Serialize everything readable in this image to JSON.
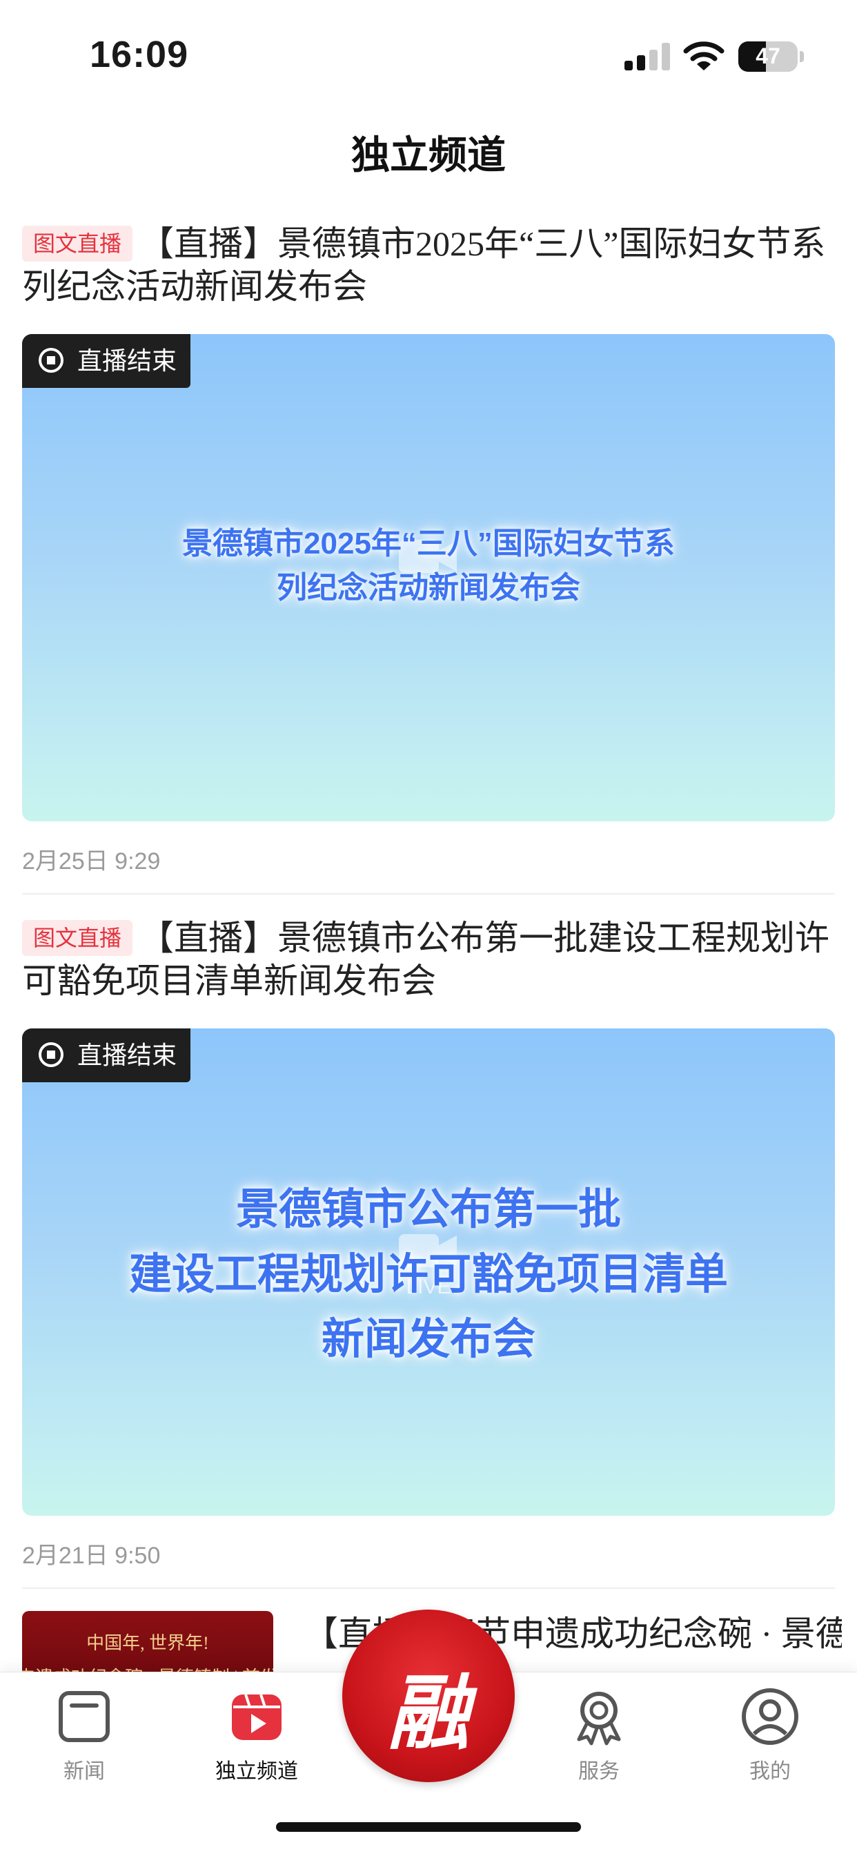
{
  "status_bar": {
    "time": "16:09",
    "battery": "47",
    "battery_level": 0.47
  },
  "header": {
    "title": "独立频道"
  },
  "feed": [
    {
      "tag": "图文直播",
      "headline": "【直播】景德镇市2025年“三八”国际妇女节系列纪念活动新闻发布会",
      "badge": "直播结束",
      "banner_lines": [
        "景德镇市2025年“三八”国际妇女节系",
        "列纪念活动新闻发布会"
      ],
      "date": "2月25日  9:29"
    },
    {
      "tag": "图文直播",
      "headline": "【直播】景德镇市公布第一批建设工程规划许可豁免项目清单新闻发布会",
      "badge": "直播结束",
      "banner_lines": [
        "景德镇市公布第一批",
        "建设工程规划许可豁免项目清单",
        "新闻发布会"
      ],
      "watermark": "LIVE",
      "date": "2月21日  9:50"
    },
    {
      "headline": "【直播】春节申遗成功纪念碗 · 景德镇制首发仪式",
      "thumb_lines": [
        "中国年, 世界年!",
        "申遗成功纪念碗 · 景德镇制 | 首发"
      ]
    }
  ],
  "tab_bar": {
    "tabs": [
      {
        "label": "新闻",
        "icon": "news-icon"
      },
      {
        "label": "独立频道",
        "icon": "channel-icon",
        "active": true
      },
      {
        "label": "服务",
        "icon": "service-icon"
      },
      {
        "label": "我的",
        "icon": "profile-icon"
      }
    ],
    "center_label": "融",
    "accent_color": "#e5323e"
  }
}
